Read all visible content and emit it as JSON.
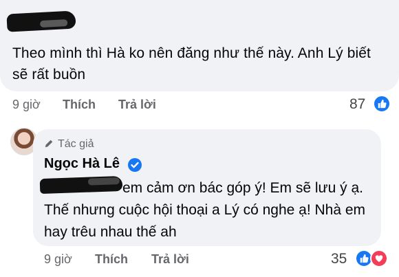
{
  "comments": [
    {
      "author": "",
      "text": "Theo mình thì Hà ko nên đăng như thế này.  Anh Lý biết sẽ rất buồn",
      "time": "9 giờ",
      "like_label": "Thích",
      "reply_label": "Trả lời",
      "reaction_count": "87",
      "reactions": [
        "like-icon"
      ]
    },
    {
      "author_tag": "Tác giả",
      "author": "Ngọc Hà Lê",
      "verified": true,
      "text": "em cảm ơn bác góp ý! Em sẽ lưu ý ạ. Thế nhưng cuộc hội thoại a Lý có nghe ạ! Nhà em hay trêu nhau thế ah",
      "time": "9 giờ",
      "like_label": "Thích",
      "reply_label": "Trả lời",
      "reaction_count": "35",
      "reactions": [
        "like-icon",
        "love-icon"
      ]
    }
  ],
  "colors": {
    "bubble": "#f0f2f5",
    "meta_text": "#65676b",
    "like_blue": "#1877f2",
    "love_red": "#f33e58"
  }
}
